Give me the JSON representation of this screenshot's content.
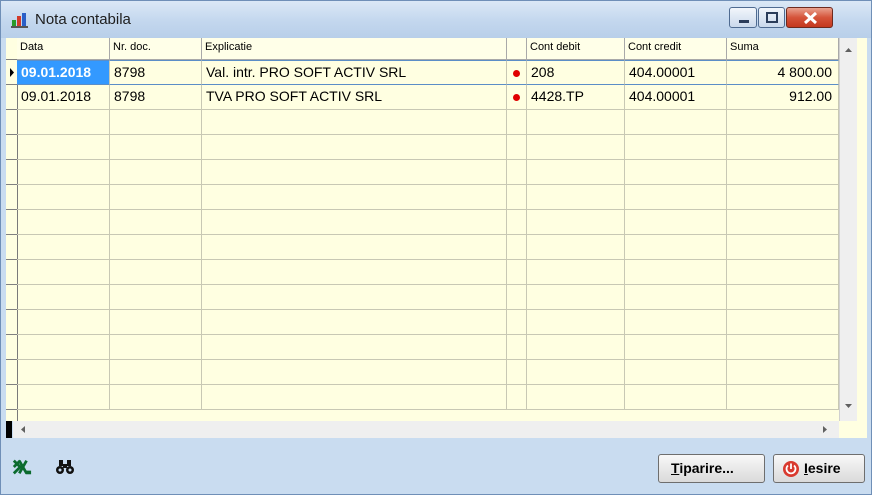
{
  "window": {
    "title": "Nota contabila"
  },
  "table": {
    "columns": [
      "Data",
      "Nr. doc.",
      "Explicatie",
      "",
      "Cont debit",
      "Cont credit",
      "Suma"
    ],
    "rows": [
      {
        "data": "09.01.2018",
        "nr_doc": "8798",
        "explicatie": "Val. intr. PRO SOFT ACTIV SRL",
        "cont_debit": "208",
        "cont_credit": "404.00001",
        "suma": "4 800.00"
      },
      {
        "data": "09.01.2018",
        "nr_doc": "8798",
        "explicatie": "TVA PRO SOFT ACTIV SRL",
        "cont_debit": "4428.TP",
        "cont_credit": "404.00001",
        "suma": "912.00"
      }
    ]
  },
  "buttons": {
    "print_first": "T",
    "print_rest": "iparire...",
    "exit_first": "I",
    "exit_rest": "esire"
  },
  "icons": {
    "excel": "excel-icon",
    "search": "binoculars-icon"
  },
  "colors": {
    "selection": "#3399ff",
    "grid_bg": "#ffffe1",
    "marker": "#e00000"
  }
}
